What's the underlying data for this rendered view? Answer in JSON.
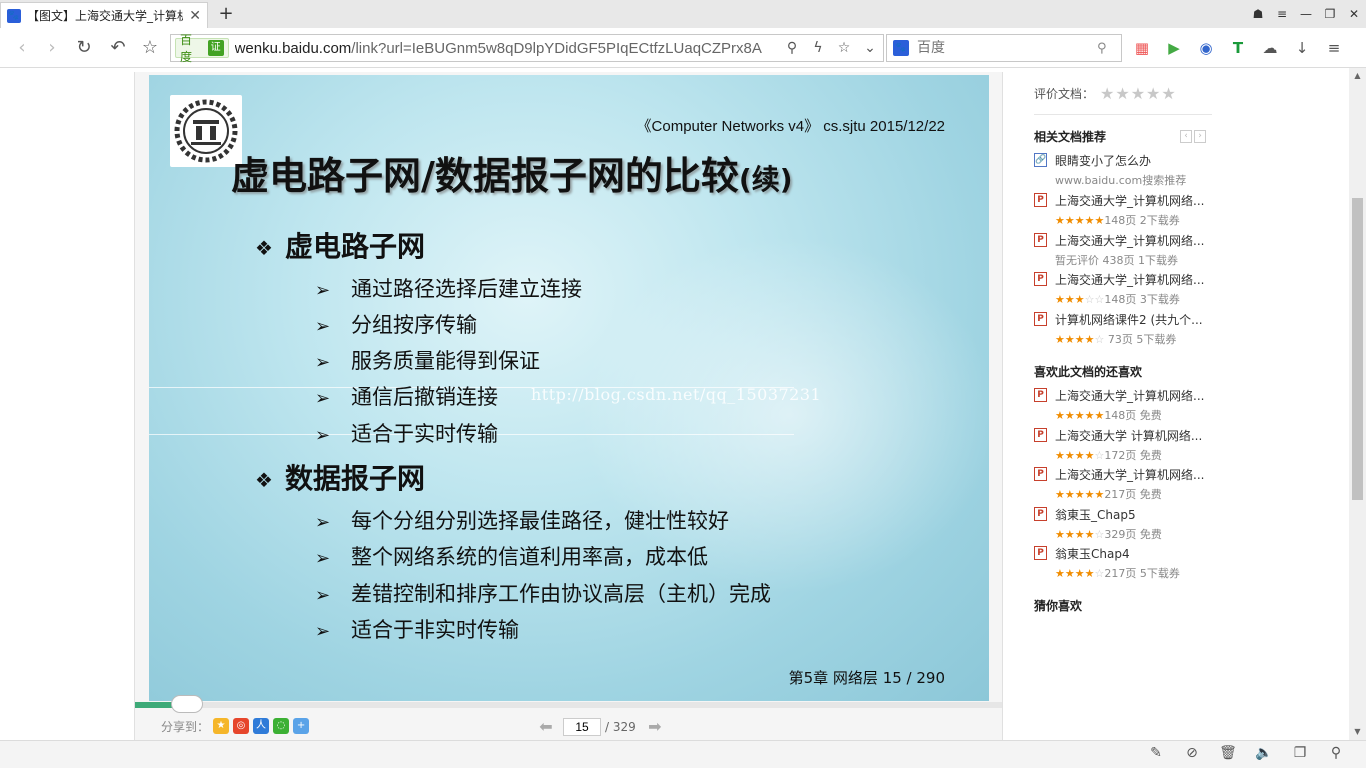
{
  "browser": {
    "tab": {
      "title": "【图文】上海交通大学_计算机网络",
      "favicon": "baidu-paw-icon"
    },
    "address": {
      "badge": "百度",
      "cert": "证",
      "url_host": "wenku.baidu.com",
      "url_rest": "/link?url=IeBUGnm5w8qD9lpYDidGF5PIqECtfzLUaqCZPrx8A"
    },
    "search": {
      "placeholder": "百度"
    }
  },
  "slide": {
    "header": "《Computer Networks v4》  cs.sjtu  2015/12/22",
    "title_main": "虚电路子网/数据报子网的比较",
    "title_suffix": "(续)",
    "sections": [
      {
        "heading": "虚电路子网",
        "items": [
          "通过路径选择后建立连接",
          "分组按序传输",
          "服务质量能得到保证",
          "通信后撤销连接",
          "适合于实时传输"
        ]
      },
      {
        "heading": "数据报子网",
        "items": [
          "每个分组分别选择最佳路径，健壮性较好",
          "整个网络系统的信道利用率高，成本低",
          "差错控制和排序工作由协议高层（主机）完成",
          "适合于非实时传输"
        ]
      }
    ],
    "watermark": "http://blog.csdn.net/qq_15037231",
    "footer": "第5章 网络层 15 / 290"
  },
  "viewer": {
    "share_label": "分享到：",
    "current_page": "15",
    "total_pages": "/ 329",
    "progress": 0.046
  },
  "sidebar": {
    "rate_label": "评价文档：",
    "related_title": "相关文档推荐",
    "related": [
      {
        "icon": "link",
        "title": "眼睛变小了怎么办",
        "meta_text": "www.baidu.com搜索推荐",
        "stars_on": "",
        "stars_off": ""
      },
      {
        "icon": "ppt",
        "title": "上海交通大学_计算机网络...",
        "stars_on": "★★★★★",
        "stars_off": "",
        "meta_text": "148页 2下载券"
      },
      {
        "icon": "ppt",
        "title": "上海交通大学_计算机网络...",
        "stars_on": "",
        "stars_off": "",
        "meta_text": "暂无评价    438页 1下载券"
      },
      {
        "icon": "ppt",
        "title": "上海交通大学_计算机网络...",
        "stars_on": "★★★",
        "stars_off": "☆☆",
        "meta_text": "148页 3下载券"
      },
      {
        "icon": "ppt",
        "title": "计算机网络课件2 (共九个...",
        "stars_on": "★★★★",
        "stars_off": "☆",
        "meta_text": " 73页  5下载券"
      }
    ],
    "liked_title": "喜欢此文档的还喜欢",
    "liked": [
      {
        "icon": "ppt",
        "title": "上海交通大学_计算机网络...",
        "stars_on": "★★★★★",
        "stars_off": "",
        "meta_text": "148页 免费"
      },
      {
        "icon": "ppt",
        "title": "上海交通大学 计算机网络...",
        "stars_on": "★★★★",
        "stars_off": "☆",
        "meta_text": "172页 免费"
      },
      {
        "icon": "ppt",
        "title": "上海交通大学_计算机网络...",
        "stars_on": "★★★★★",
        "stars_off": "",
        "meta_text": "217页 免费"
      },
      {
        "icon": "ppt",
        "title": "翁東玉_Chap5",
        "stars_on": "★★★★",
        "stars_off": "☆",
        "meta_text": "329页 免费"
      },
      {
        "icon": "ppt",
        "title": "翁東玉Chap4",
        "stars_on": "★★★★",
        "stars_off": "☆",
        "meta_text": "217页 5下载券"
      }
    ],
    "guess_title": "猜你喜欢"
  },
  "colors": {
    "accent_green": "#3daa78",
    "star_orange": "#f08c00",
    "slide_blue": "#9fd4e2"
  }
}
